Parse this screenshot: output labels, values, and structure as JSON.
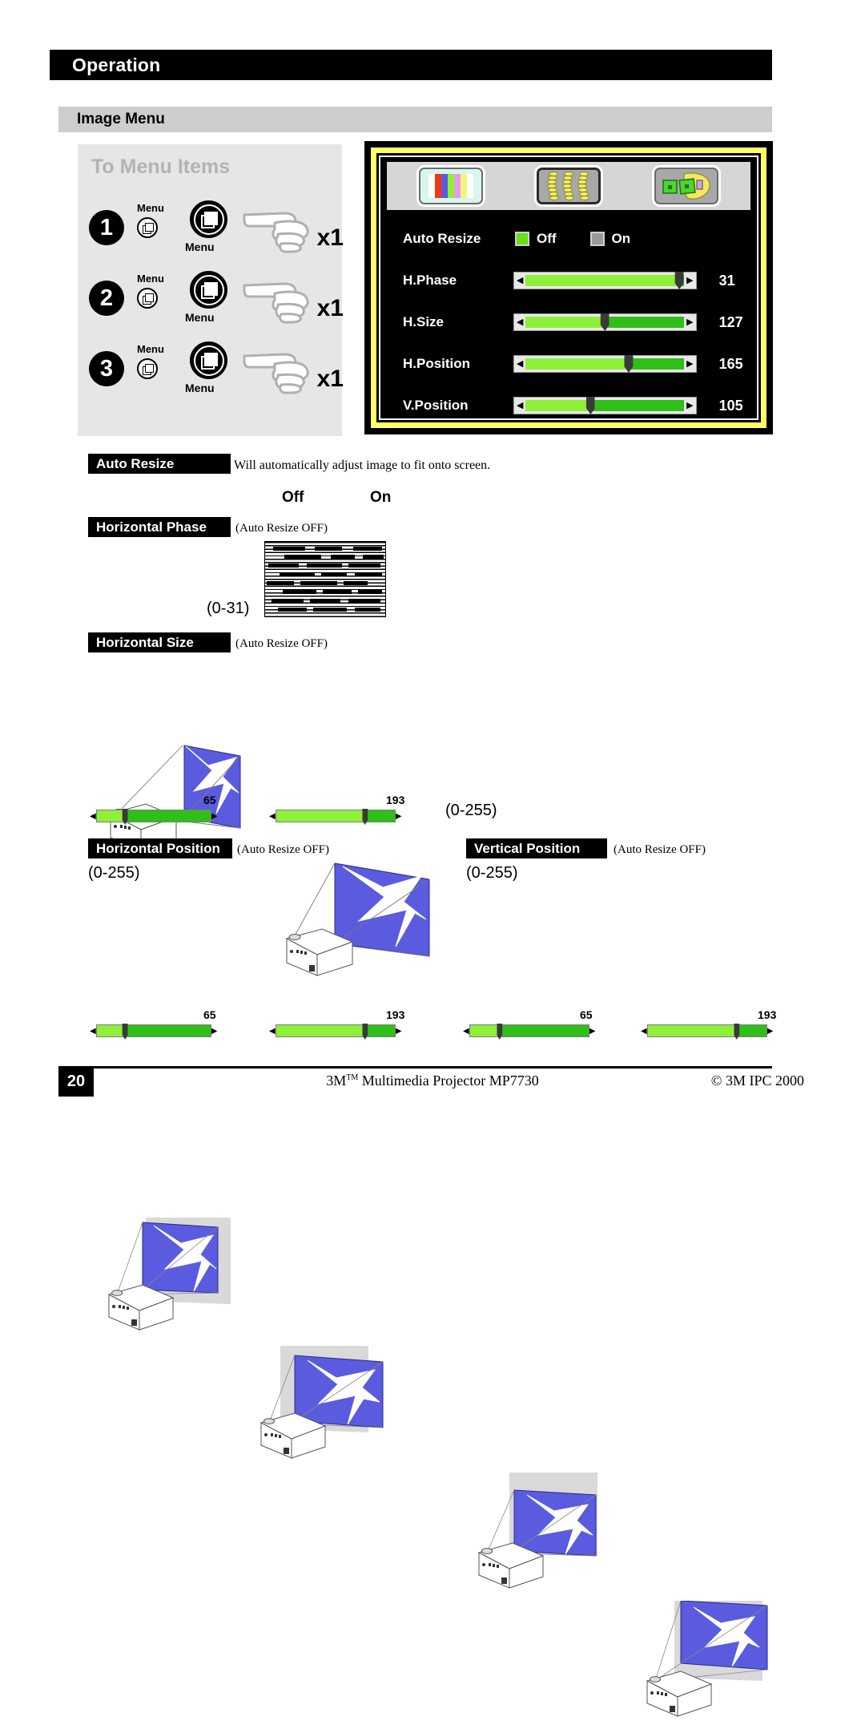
{
  "header": {
    "chapter_title": "Operation",
    "section_title": "Image Menu"
  },
  "menu_panel": {
    "title": "To Menu Items",
    "steps": [
      {
        "number": "1",
        "small_label": "Menu",
        "button_label": "Menu",
        "press_count": "x1"
      },
      {
        "number": "2",
        "small_label": "Menu",
        "button_label": "Menu",
        "press_count": "x1"
      },
      {
        "number": "3",
        "small_label": "Menu",
        "button_label": "Menu",
        "press_count": "x1"
      }
    ]
  },
  "osd": {
    "tabs": [
      {
        "name": "color-bars-tab",
        "selected": true
      },
      {
        "name": "keystone-tab",
        "selected": false
      },
      {
        "name": "setup-tab",
        "selected": false
      }
    ],
    "auto_resize": {
      "label": "Auto Resize",
      "options": [
        {
          "label": "Off",
          "selected": true
        },
        {
          "label": "On",
          "selected": false
        }
      ]
    },
    "sliders": [
      {
        "label": "H.Phase",
        "value": "31",
        "percent": 97
      },
      {
        "label": "H.Size",
        "value": "127",
        "percent": 50
      },
      {
        "label": "H.Position",
        "value": "165",
        "percent": 65
      },
      {
        "label": "V.Position",
        "value": "105",
        "percent": 41
      }
    ]
  },
  "entries": {
    "auto_resize": {
      "label": "Auto Resize",
      "description": "Will automatically adjust image to fit onto screen.",
      "off_label": "Off",
      "on_label": "On"
    },
    "horizontal_phase": {
      "label": "Horizontal Phase",
      "note": "(Auto Resize OFF)",
      "range": "(0-31)"
    },
    "horizontal_size": {
      "label": "Horizontal Size",
      "note": "(Auto Resize OFF)",
      "range": "(0-255)",
      "samples": [
        {
          "value": "65",
          "percent": 25
        },
        {
          "value": "193",
          "percent": 75
        }
      ]
    },
    "horizontal_position": {
      "label": "Horizontal Position",
      "note": "(Auto Resize OFF)",
      "range": "(0-255)",
      "samples": [
        {
          "value": "65",
          "percent": 25
        },
        {
          "value": "193",
          "percent": 75
        }
      ]
    },
    "vertical_position": {
      "label": "Vertical Position",
      "note": "(Auto Resize OFF)",
      "range": "(0-255)",
      "samples": [
        {
          "value": "65",
          "percent": 25
        },
        {
          "value": "193",
          "percent": 75
        }
      ]
    }
  },
  "footer": {
    "page_number": "20",
    "product_prefix": "3M",
    "product_tm": "TM",
    "product_suffix": " Multimedia Projector MP7730",
    "copyright": "© 3M IPC 2000"
  }
}
